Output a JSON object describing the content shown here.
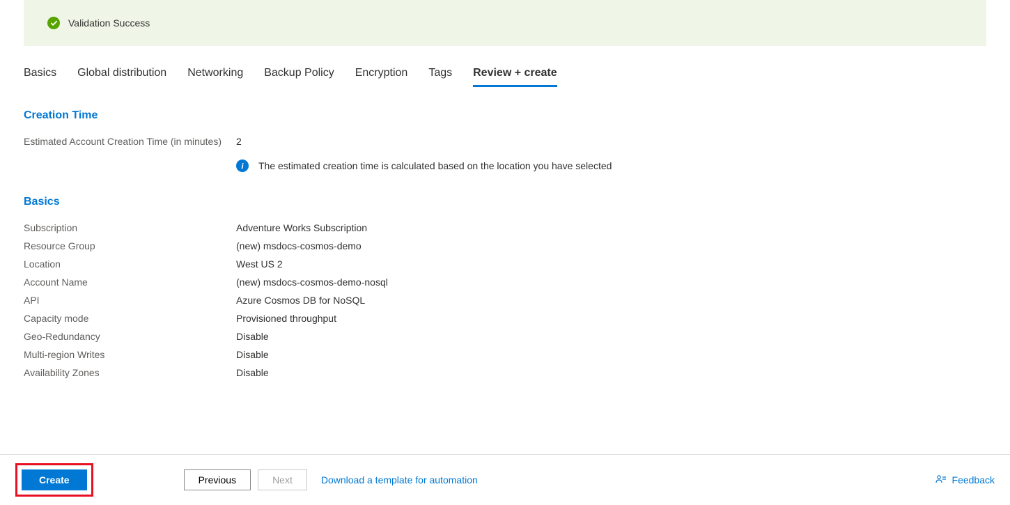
{
  "validation": {
    "message": "Validation Success"
  },
  "tabs": [
    {
      "label": "Basics"
    },
    {
      "label": "Global distribution"
    },
    {
      "label": "Networking"
    },
    {
      "label": "Backup Policy"
    },
    {
      "label": "Encryption"
    },
    {
      "label": "Tags"
    },
    {
      "label": "Review + create"
    }
  ],
  "sections": {
    "creation_time": {
      "heading": "Creation Time",
      "est_label": "Estimated Account Creation Time (in minutes)",
      "est_value": "2",
      "info": "The estimated creation time is calculated based on the location you have selected"
    },
    "basics": {
      "heading": "Basics",
      "rows": [
        {
          "label": "Subscription",
          "value": "Adventure Works Subscription"
        },
        {
          "label": "Resource Group",
          "value": "(new) msdocs-cosmos-demo"
        },
        {
          "label": "Location",
          "value": "West US 2"
        },
        {
          "label": "Account Name",
          "value": "(new) msdocs-cosmos-demo-nosql"
        },
        {
          "label": "API",
          "value": "Azure Cosmos DB for NoSQL"
        },
        {
          "label": "Capacity mode",
          "value": "Provisioned throughput"
        },
        {
          "label": "Geo-Redundancy",
          "value": "Disable"
        },
        {
          "label": "Multi-region Writes",
          "value": "Disable"
        },
        {
          "label": "Availability Zones",
          "value": "Disable"
        }
      ]
    }
  },
  "footer": {
    "create": "Create",
    "previous": "Previous",
    "next": "Next",
    "download_link": "Download a template for automation",
    "feedback": "Feedback"
  }
}
